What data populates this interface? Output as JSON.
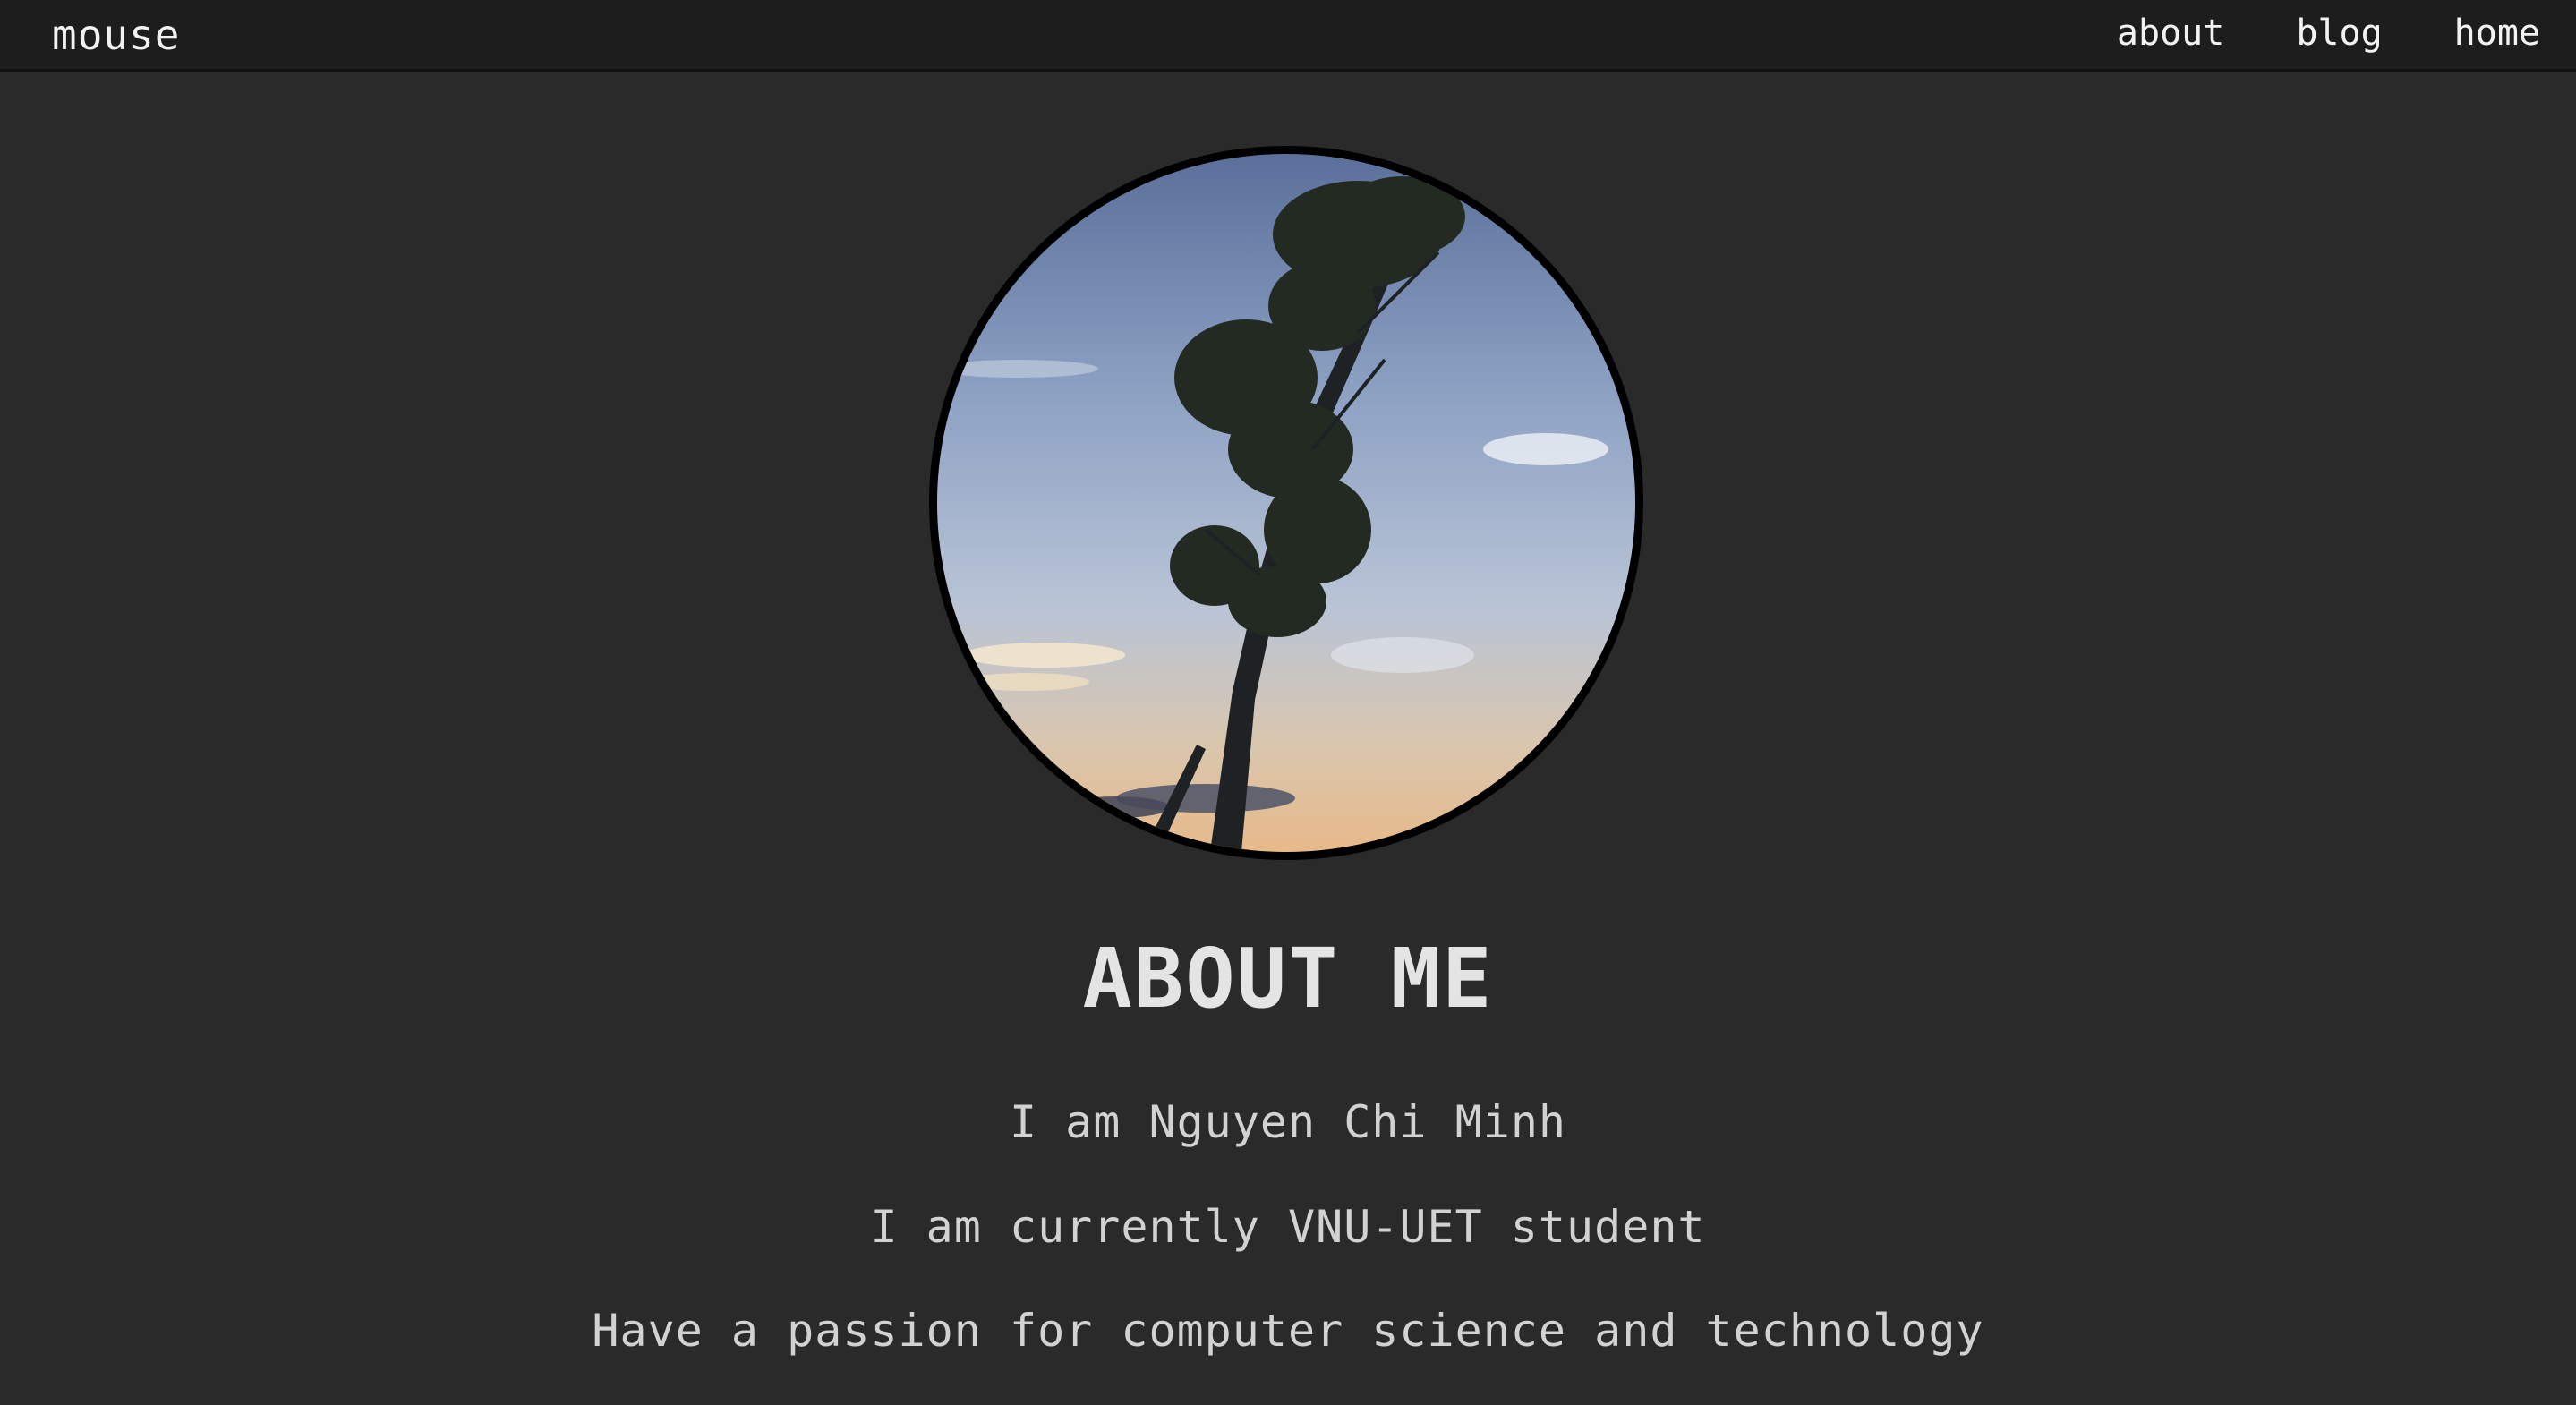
{
  "nav": {
    "brand": "mouse",
    "links": [
      "about",
      "blog",
      "home"
    ]
  },
  "profile": {
    "image_alt": "circular profile photo of a tree silhouette against a sunset sky"
  },
  "about": {
    "title": "ABOUT ME",
    "lines": [
      "I am Nguyen Chi Minh",
      "I am currently VNU-UET student",
      "Have a passion for computer science and technology"
    ]
  },
  "colors": {
    "page_background": "#2a2a2a",
    "navbar_background": "#1d1d1d",
    "text": "#d6d6d6"
  }
}
